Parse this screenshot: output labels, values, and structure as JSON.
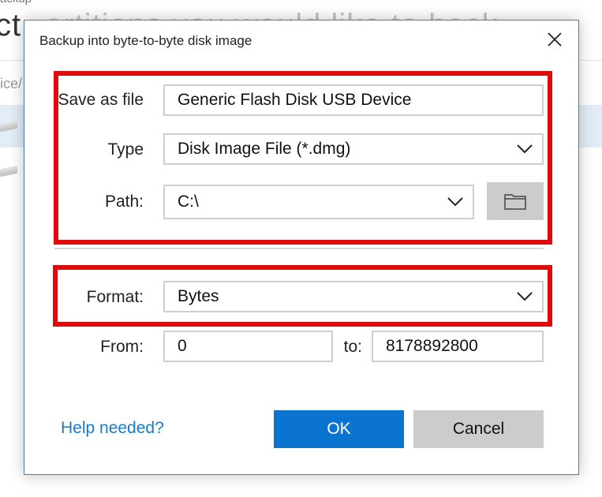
{
  "background": {
    "window_title_fragment": "ackup",
    "heading_fragment_start": "ct",
    "heading_fragment_faded": "artitions you would like to back",
    "path_fragment": "ice/"
  },
  "dialog": {
    "title": "Backup into byte-to-byte disk image",
    "close_icon": "close-icon"
  },
  "form": {
    "save_as_label": "Save as file",
    "save_as_value": "Generic Flash Disk USB Device",
    "type_label": "Type",
    "type_value": "Disk Image File (*.dmg)",
    "path_label": "Path:",
    "path_value": "C:\\",
    "browse_icon": "folder-icon",
    "format_label": "Format:",
    "format_value": "Bytes",
    "from_label": "From:",
    "from_value": "0",
    "to_label": "to:",
    "to_value": "8178892800"
  },
  "footer": {
    "help_label": "Help needed?",
    "ok_label": "OK",
    "cancel_label": "Cancel"
  },
  "colors": {
    "highlight": "#e10a0a",
    "primary_button": "#0b74d1",
    "link": "#1a79c9"
  }
}
